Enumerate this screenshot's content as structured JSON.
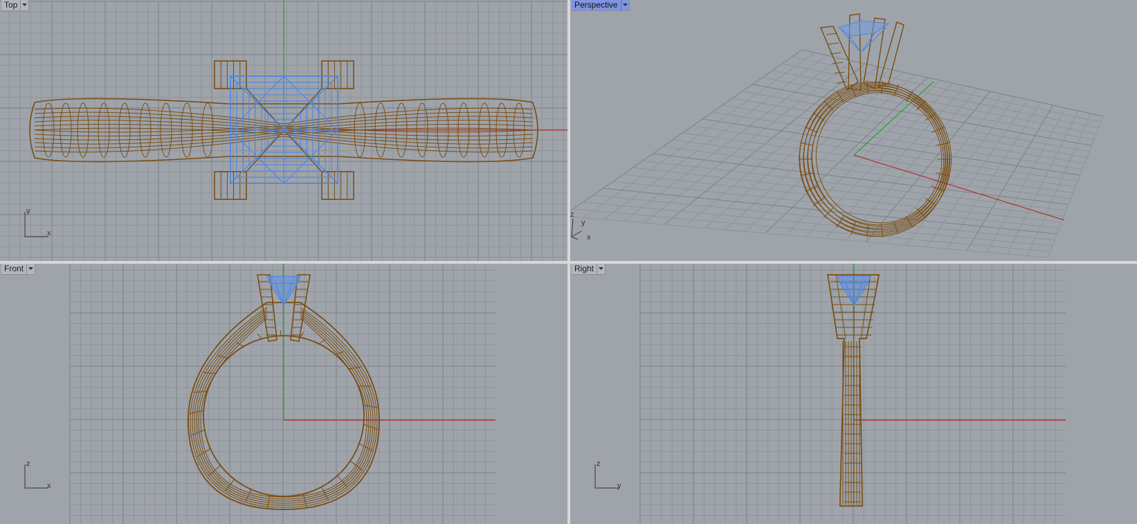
{
  "viewports": {
    "top": {
      "label": "Top",
      "active": false,
      "axis_h": "x",
      "axis_v": "y"
    },
    "perspective": {
      "label": "Perspective",
      "active": true,
      "axis_x": "x",
      "axis_y": "y",
      "axis_z": "z"
    },
    "front": {
      "label": "Front",
      "active": false,
      "axis_h": "x",
      "axis_v": "z"
    },
    "right": {
      "label": "Right",
      "active": false,
      "axis_h": "y",
      "axis_v": "z"
    }
  },
  "colors": {
    "background": "#9fa4ab",
    "grid_minor": "#8e939a",
    "grid_major": "#7b8087",
    "axis_x": "#b03030",
    "axis_y": "#2aa02a",
    "wire_gold": "#7a4c10",
    "wire_blue": "#4a86e8",
    "active_label": "#7f95df"
  },
  "icons": {
    "dropdown": "caret-down-icon"
  }
}
